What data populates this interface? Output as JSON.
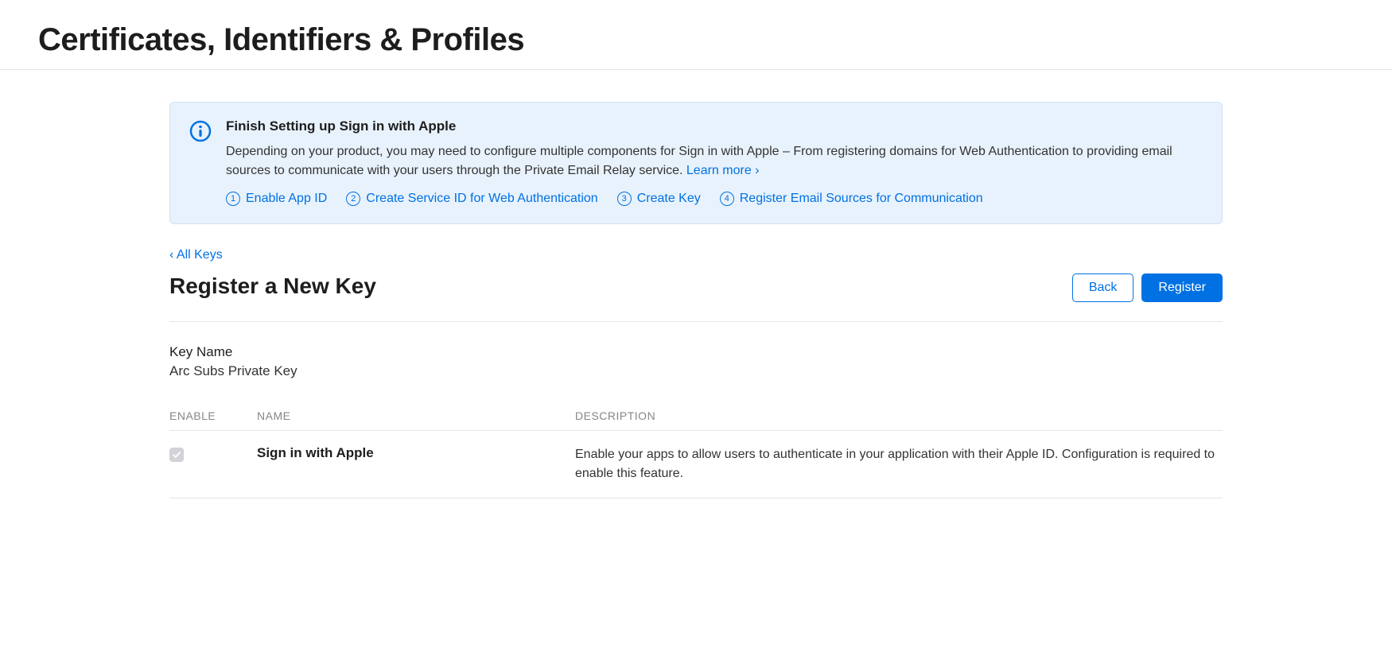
{
  "page": {
    "title": "Certificates, Identifiers & Profiles"
  },
  "banner": {
    "title": "Finish Setting up Sign in with Apple",
    "description": "Depending on your product, you may need to configure multiple components for Sign in with Apple – From registering domains for Web Authentication to providing email sources to communicate with your users through the Private Email Relay service. ",
    "learn_more": "Learn more ›",
    "steps": [
      {
        "num": "1",
        "label": "Enable App ID"
      },
      {
        "num": "2",
        "label": "Create Service ID for Web Authentication"
      },
      {
        "num": "3",
        "label": "Create Key"
      },
      {
        "num": "4",
        "label": "Register Email Sources for Communication"
      }
    ]
  },
  "back_link": "‹ All Keys",
  "section": {
    "title": "Register a New Key",
    "back_label": "Back",
    "register_label": "Register"
  },
  "key": {
    "label": "Key Name",
    "value": "Arc Subs Private Key"
  },
  "table": {
    "headers": {
      "enable": "ENABLE",
      "name": "NAME",
      "description": "DESCRIPTION"
    },
    "rows": [
      {
        "enabled": true,
        "name": "Sign in with Apple",
        "description": "Enable your apps to allow users to authenticate in your application with their Apple ID. Configuration is required to enable this feature."
      }
    ]
  }
}
